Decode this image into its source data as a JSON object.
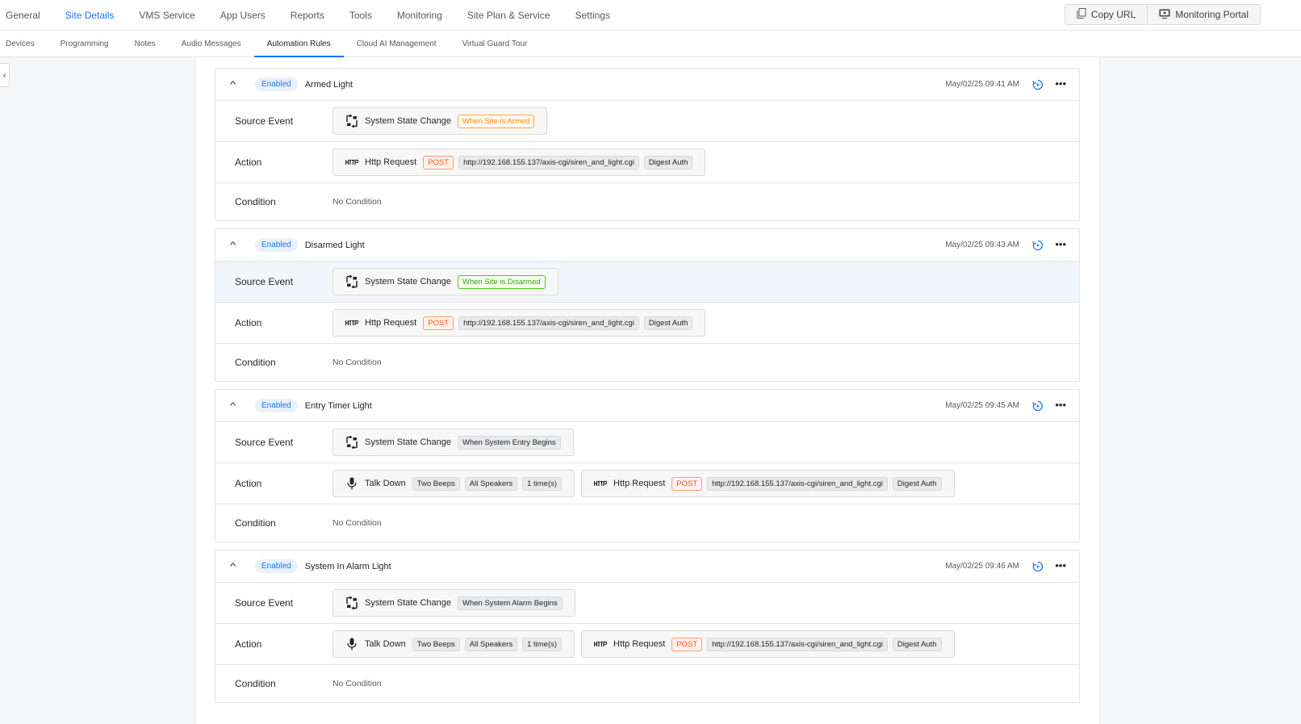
{
  "topnav": {
    "items": [
      "General",
      "Site Details",
      "VMS Service",
      "App Users",
      "Reports",
      "Tools",
      "Monitoring",
      "Site Plan & Service",
      "Settings"
    ],
    "active": "Site Details"
  },
  "top_actions": {
    "copy_url": "Copy URL",
    "monitoring_portal": "Monitoring Portal"
  },
  "subnav": {
    "tabs": [
      "Devices",
      "Programming",
      "Notes",
      "Audio Messages",
      "Automation Rules",
      "Cloud AI Management",
      "Virtual Guard Tour"
    ],
    "active": "Automation Rules"
  },
  "labels": {
    "source_event": "Source Event",
    "action": "Action",
    "condition": "Condition"
  },
  "rules": [
    {
      "status": "Enabled",
      "name": "Armed Light",
      "timestamp": "May/02/25 09:41 AM",
      "source": {
        "title": "System State Change",
        "tag": "When Site is Armed"
      },
      "talk": null,
      "http": {
        "title": "Http Request",
        "method": "POST",
        "url": "http://192.168.155.137/axis-cgi/siren_and_light.cgi",
        "auth": "Digest Auth"
      },
      "condition": "No Condition"
    },
    {
      "status": "Enabled",
      "name": "Disarmed Light",
      "timestamp": "May/02/25 09:43 AM",
      "source": {
        "title": "System State Change",
        "tag": "When Site is Disarmed"
      },
      "talk": null,
      "http": {
        "title": "Http Request",
        "method": "POST",
        "url": "http://192.168.155.137/axis-cgi/siren_and_light.cgi",
        "auth": "Digest Auth"
      },
      "condition": "No Condition"
    },
    {
      "status": "Enabled",
      "name": "Entry Timer Light",
      "timestamp": "May/02/25 09:45 AM",
      "source": {
        "title": "System State Change",
        "tag": "When System Entry Begins"
      },
      "talk": {
        "title": "Talk Down",
        "sound": "Two Beeps",
        "speakers": "All Speakers",
        "times": "1 time(s)"
      },
      "http": {
        "title": "Http Request",
        "method": "POST",
        "url": "http://192.168.155.137/axis-cgi/siren_and_light.cgi",
        "auth": "Digest Auth"
      },
      "condition": "No Condition"
    },
    {
      "status": "Enabled",
      "name": "System In Alarm Light",
      "timestamp": "May/02/25 09:46 AM",
      "source": {
        "title": "System State Change",
        "tag": "When System Alarm Begins"
      },
      "talk": {
        "title": "Talk Down",
        "sound": "Two Beeps",
        "speakers": "All Speakers",
        "times": "1 time(s)"
      },
      "http": {
        "title": "Http Request",
        "method": "POST",
        "url": "http://192.168.155.137/axis-cgi/siren_and_light.cgi",
        "auth": "Digest Auth"
      },
      "condition": "No Condition"
    }
  ],
  "icons": {
    "state_change": "state-change-icon",
    "http": "http-icon",
    "mic": "microphone-icon",
    "run": "run-rule-icon",
    "more": "more-icon",
    "chevron": "chevron-up-icon"
  },
  "colors": {
    "accent": "#1677ff",
    "armed_tag": "#fa8c16",
    "disarmed_tag": "#389e0d",
    "post_tag": "#fa541c"
  }
}
